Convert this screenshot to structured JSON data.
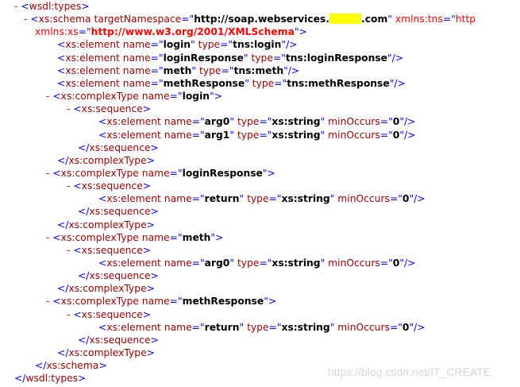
{
  "root_open": {
    "toggle": "-",
    "tag": "wsdl:types"
  },
  "schema": {
    "toggle": "-",
    "tag": "xs:schema",
    "attr1_name": "targetNamespace",
    "attr1_value_prefix": "http://soap.webservices.",
    "attr1_value_suffix": ".com",
    "attr2_name": "xmlns:tns",
    "attr2_value_visible": "http",
    "attr3_name": "xmlns:xs",
    "attr3_value": "http://www.w3.org/2001/XMLSchema"
  },
  "top_elements": [
    {
      "tag": "xs:element",
      "a1": "name",
      "v1": "login",
      "a2": "type",
      "v2": "tns:login"
    },
    {
      "tag": "xs:element",
      "a1": "name",
      "v1": "loginResponse",
      "a2": "type",
      "v2": "tns:loginResponse"
    },
    {
      "tag": "xs:element",
      "a1": "name",
      "v1": "meth",
      "a2": "type",
      "v2": "tns:meth"
    },
    {
      "tag": "xs:element",
      "a1": "name",
      "v1": "methResponse",
      "a2": "type",
      "v2": "tns:methResponse"
    }
  ],
  "complex_types": [
    {
      "toggle": "-",
      "tag": "xs:complexType",
      "attr": "name",
      "value": "login",
      "seq_toggle": "-",
      "seq_tag": "xs:sequence",
      "elements": [
        {
          "tag": "xs:element",
          "a1": "name",
          "v1": "arg0",
          "a2": "type",
          "v2": "xs:string",
          "a3": "minOccurs",
          "v3": "0"
        },
        {
          "tag": "xs:element",
          "a1": "name",
          "v1": "arg1",
          "a2": "type",
          "v2": "xs:string",
          "a3": "minOccurs",
          "v3": "0"
        }
      ],
      "seq_close": "xs:sequence",
      "close": "xs:complexType"
    },
    {
      "toggle": "-",
      "tag": "xs:complexType",
      "attr": "name",
      "value": "loginResponse",
      "seq_toggle": "-",
      "seq_tag": "xs:sequence",
      "elements": [
        {
          "tag": "xs:element",
          "a1": "name",
          "v1": "return",
          "a2": "type",
          "v2": "xs:string",
          "a3": "minOccurs",
          "v3": "0"
        }
      ],
      "seq_close": "xs:sequence",
      "close": "xs:complexType"
    },
    {
      "toggle": "-",
      "tag": "xs:complexType",
      "attr": "name",
      "value": "meth",
      "seq_toggle": "-",
      "seq_tag": "xs:sequence",
      "elements": [
        {
          "tag": "xs:element",
          "a1": "name",
          "v1": "arg0",
          "a2": "type",
          "v2": "xs:string",
          "a3": "minOccurs",
          "v3": "0"
        }
      ],
      "seq_close": "xs:sequence",
      "close": "xs:complexType"
    },
    {
      "toggle": "-",
      "tag": "xs:complexType",
      "attr": "name",
      "value": "methResponse",
      "seq_toggle": "-",
      "seq_tag": "xs:sequence",
      "elements": [
        {
          "tag": "xs:element",
          "a1": "name",
          "v1": "return",
          "a2": "type",
          "v2": "xs:string",
          "a3": "minOccurs",
          "v3": "0"
        }
      ],
      "seq_close": "xs:sequence",
      "close": "xs:complexType"
    }
  ],
  "schema_close": "xs:schema",
  "root_close": "wsdl:types",
  "watermark": "https://blog.csdn.net/IT_CREATE",
  "colors": {
    "tag_name": "#990000",
    "punctuation": "#0000ff",
    "attribute_value": "#000000",
    "namespace_attr": "#ff0000",
    "toggle": "#ff0000",
    "redaction": "#ffff00"
  }
}
